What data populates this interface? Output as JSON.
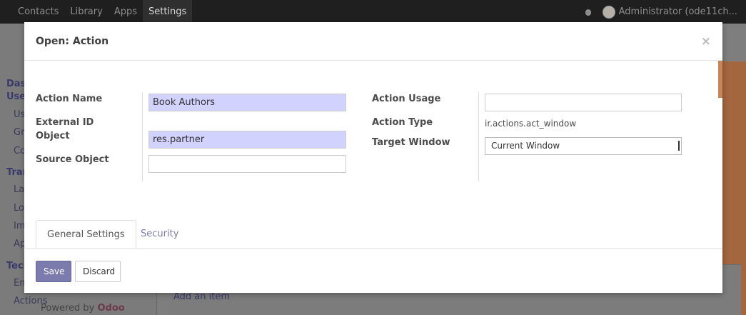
{
  "navbar": {
    "items": [
      "Contacts",
      "Library",
      "Apps",
      "Settings"
    ],
    "active": "Settings",
    "user": "Administrator (ode11ch..."
  },
  "background": {
    "sidebar_fragments": [
      "Dash",
      "Use",
      "Us",
      "Gro",
      "Co",
      "Tran",
      "La",
      "Loa",
      "Im",
      "Ap",
      "Tech",
      "Em",
      "Actions"
    ],
    "powered_by": "Powered by",
    "powered_brand": "Odoo",
    "add_item": "Add an item"
  },
  "modal": {
    "title": "Open: Action",
    "close": "×",
    "fields_left": {
      "action_name_label": "Action Name",
      "action_name_value": "Book Authors",
      "external_id_label": "External ID",
      "object_label": "Object",
      "object_value": "res.partner",
      "source_object_label": "Source Object",
      "source_object_value": ""
    },
    "fields_right": {
      "action_usage_label": "Action Usage",
      "action_usage_value": "",
      "action_type_label": "Action Type",
      "action_type_value": "ir.actions.act_window",
      "target_window_label": "Target Window",
      "target_window_value": "Current Window"
    },
    "tabs": [
      "General Settings",
      "Security"
    ],
    "active_tab": "General Settings",
    "buttons": {
      "save": "Save",
      "discard": "Discard"
    }
  },
  "colors": {
    "primary": "#7c7bad",
    "required_field": "#d2d2ff",
    "accent": "#c8855a"
  }
}
